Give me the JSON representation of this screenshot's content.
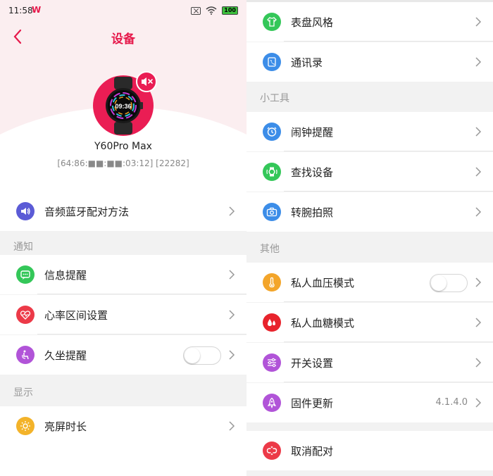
{
  "status_bar": {
    "time": "11:58",
    "app_logo": "W",
    "battery": "100"
  },
  "header": {
    "title": "设备",
    "device_name": "Y60Pro Max",
    "device_mac": "[64:86:■■:■■:03:12]  [22282]"
  },
  "watch_face": {
    "time": "09:36"
  },
  "left": {
    "top_item": {
      "label": "音频蓝牙配对方法",
      "icon": "speaker-icon",
      "color": "#5b5bd6"
    },
    "sections": [
      {
        "title": "通知",
        "items": [
          {
            "label": "信息提醒",
            "icon": "message-icon",
            "color": "#34c759"
          },
          {
            "label": "心率区间设置",
            "icon": "heart-rate-icon",
            "color": "#ec3a48"
          },
          {
            "label": "久坐提醒",
            "icon": "sedentary-icon",
            "color": "#b154d8",
            "toggle": false
          }
        ]
      },
      {
        "title": "显示",
        "items": [
          {
            "label": "亮屏时长",
            "icon": "brightness-icon",
            "color": "#f3b32a"
          }
        ]
      }
    ]
  },
  "right": {
    "top_items": [
      {
        "label": "表盘风格",
        "icon": "shirt-icon",
        "color": "#34c759"
      },
      {
        "label": "通讯录",
        "icon": "contacts-icon",
        "color": "#3c8de8"
      }
    ],
    "sections": [
      {
        "title": "小工具",
        "items": [
          {
            "label": "闹钟提醒",
            "icon": "alarm-icon",
            "color": "#3c8de8"
          },
          {
            "label": "查找设备",
            "icon": "find-device-icon",
            "color": "#34c759"
          },
          {
            "label": "转腕拍照",
            "icon": "camera-icon",
            "color": "#3c8de8"
          }
        ]
      },
      {
        "title": "其他",
        "items": [
          {
            "label": "私人血压模式",
            "icon": "thermometer-icon",
            "color": "#f3a52a",
            "toggle": false
          },
          {
            "label": "私人血糖模式",
            "icon": "blood-drop-icon",
            "color": "#e8232c"
          },
          {
            "label": "开关设置",
            "icon": "sliders-icon",
            "color": "#b154d8"
          },
          {
            "label": "固件更新",
            "icon": "rocket-icon",
            "color": "#b154d8",
            "value": "4.1.4.0"
          }
        ]
      }
    ],
    "bottom_item": {
      "label": "取消配对",
      "icon": "unlink-icon",
      "color": "#ec3a48"
    }
  }
}
